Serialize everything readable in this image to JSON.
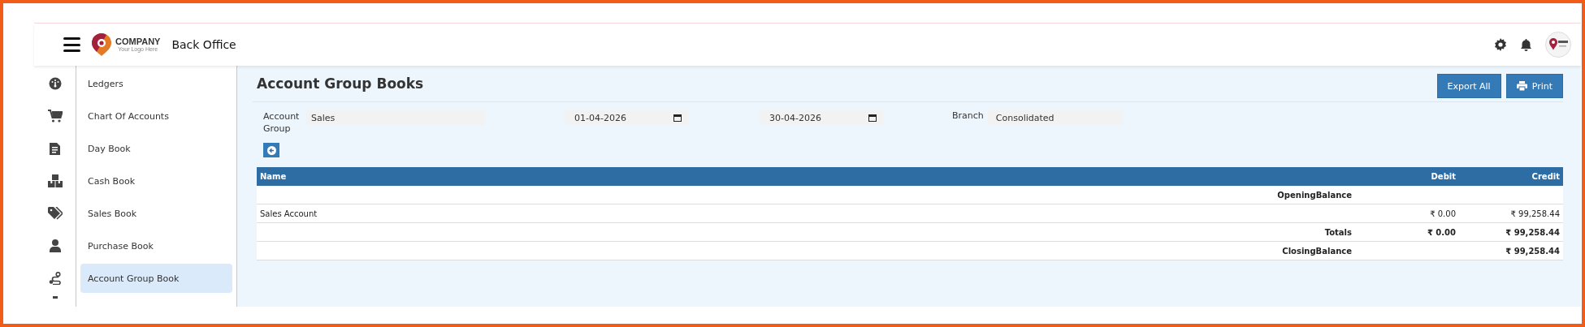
{
  "header": {
    "logo_name": "COMPANY",
    "logo_tagline": "Your Logo Here",
    "app_title": "Back Office"
  },
  "sidebar": {
    "items": [
      {
        "label": "Ledgers",
        "kind": "gauge",
        "selected": false
      },
      {
        "label": "Chart Of Accounts",
        "kind": "cart",
        "selected": false
      },
      {
        "label": "Day Book",
        "kind": "doc",
        "selected": false
      },
      {
        "label": "Cash Book",
        "kind": "boxes",
        "selected": false
      },
      {
        "label": "Sales Book",
        "kind": "tags",
        "selected": false
      },
      {
        "label": "Purchase Book",
        "kind": "user",
        "selected": false
      },
      {
        "label": "Account Group Book",
        "kind": "route",
        "selected": true
      }
    ]
  },
  "page": {
    "title": "Account Group Books",
    "buttons": [
      {
        "label": "Export All",
        "kind": "plain"
      },
      {
        "label": "Print",
        "kind": "print"
      }
    ]
  },
  "filters": {
    "account_group": {
      "label": "Account Group",
      "value": "Sales"
    },
    "from_date": "01-04-2026",
    "to_date": "30-04-2026",
    "branch": {
      "label": "Branch",
      "value": "Consolidated"
    }
  },
  "table": {
    "columns": [
      "Name",
      "Debit",
      "Credit"
    ],
    "rows": [
      {
        "kind": "label",
        "name": "",
        "label": "OpeningBalance",
        "debit": "",
        "credit": ""
      },
      {
        "kind": "entry",
        "name": "Sales Account",
        "label": "",
        "debit": "₹ 0.00",
        "credit": "₹ 99,258.44"
      },
      {
        "kind": "total",
        "name": "",
        "label": "Totals",
        "debit": "₹ 0.00",
        "credit": "₹ 99,258.44"
      },
      {
        "kind": "total",
        "name": "",
        "label": "ClosingBalance",
        "debit": "",
        "credit": "₹ 99,258.44"
      }
    ]
  }
}
